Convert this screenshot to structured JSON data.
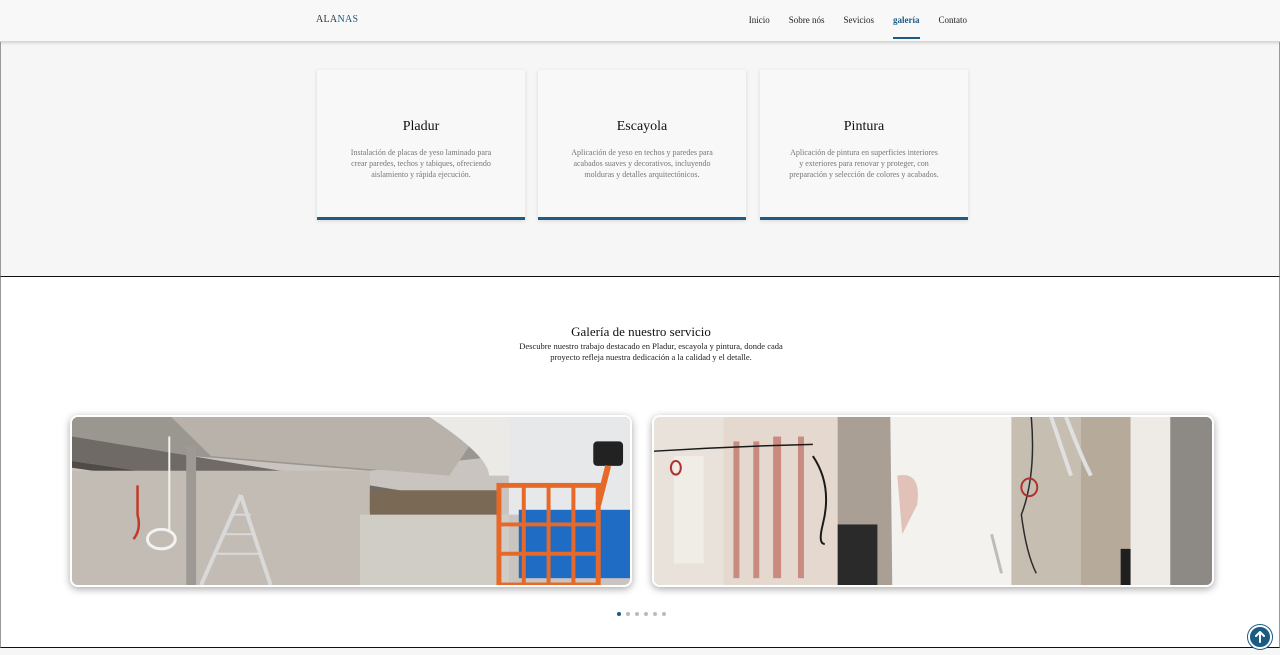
{
  "header": {
    "logo_main": "ALA",
    "logo_accent": "NAS",
    "nav": [
      {
        "label": "Inicio"
      },
      {
        "label": "Sobre nós"
      },
      {
        "label": "Sevicios"
      },
      {
        "label": "galería"
      },
      {
        "label": "Contato"
      }
    ],
    "active_nav": "galería"
  },
  "services": [
    {
      "title": "Pladur",
      "text": "Instalación de placas de yeso laminado para crear paredes, techos y tabiques, ofreciendo aislamiento y rápida ejecución."
    },
    {
      "title": "Escayola",
      "text": "Aplicación de yeso en techos y paredes para acabados suaves y decorativos, incluyendo molduras y detalles arquitectónicos."
    },
    {
      "title": "Pintura",
      "text": "Aplicación de pintura en superficies interiores y exteriores para renovar y proteger, con preparación y selección de colores y acabados."
    }
  ],
  "gallery": {
    "title": "Galería de nuestro servicio",
    "description": "Descubre nuestro trabajo destacado en Pladur, escayola y pintura, donde cada proyecto refleja nuestra dedicación a la calidad y el detalle.",
    "slides_count": 6,
    "active_slide": 1
  },
  "icons": {
    "back_to_top": "arrow-up-icon"
  },
  "colors": {
    "accent": "#1b5b82",
    "card_border": "#1d5d83"
  }
}
